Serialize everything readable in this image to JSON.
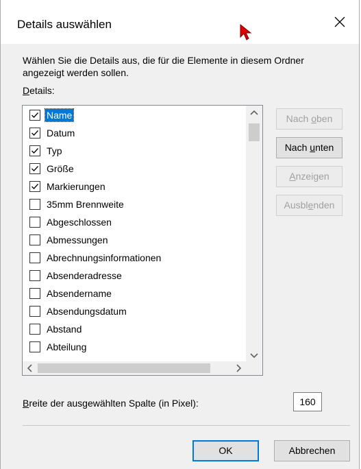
{
  "dialog": {
    "title": "Details auswählen",
    "description": "Wählen Sie die Details aus, die für die Elemente in diesem Ordner angezeigt werden sollen.",
    "details_label_prefix": "D",
    "details_label_rest": "etails:",
    "items": [
      {
        "label": "Name",
        "checked": true,
        "selected": true
      },
      {
        "label": "Datum",
        "checked": true
      },
      {
        "label": "Typ",
        "checked": true
      },
      {
        "label": "Größe",
        "checked": true
      },
      {
        "label": "Markierungen",
        "checked": true
      },
      {
        "label": "35mm Brennweite",
        "checked": false
      },
      {
        "label": "Abgeschlossen",
        "checked": false
      },
      {
        "label": "Abmessungen",
        "checked": false
      },
      {
        "label": "Abrechnungsinformationen",
        "checked": false
      },
      {
        "label": "Absenderadresse",
        "checked": false
      },
      {
        "label": "Absendername",
        "checked": false
      },
      {
        "label": "Absendungsdatum",
        "checked": false
      },
      {
        "label": "Abstand",
        "checked": false
      },
      {
        "label": "Abteilung",
        "checked": false
      }
    ],
    "buttons": {
      "move_up_pre": "Nach ",
      "move_up_key": "o",
      "move_up_post": "ben",
      "move_down_pre": "Nach ",
      "move_down_key": "u",
      "move_down_post": "nten",
      "show_key": "A",
      "show_post": "nzeigen",
      "hide_pre": "Ausbl",
      "hide_key": "e",
      "hide_post": "nden",
      "ok": "OK",
      "cancel": "Abbrechen"
    },
    "width_label_key": "B",
    "width_label_rest": "reite der ausgewählten Spalte (in Pixel):",
    "width_value": "160"
  },
  "colors": {
    "selection": "#0078d7",
    "background": "#f0f0f0"
  }
}
